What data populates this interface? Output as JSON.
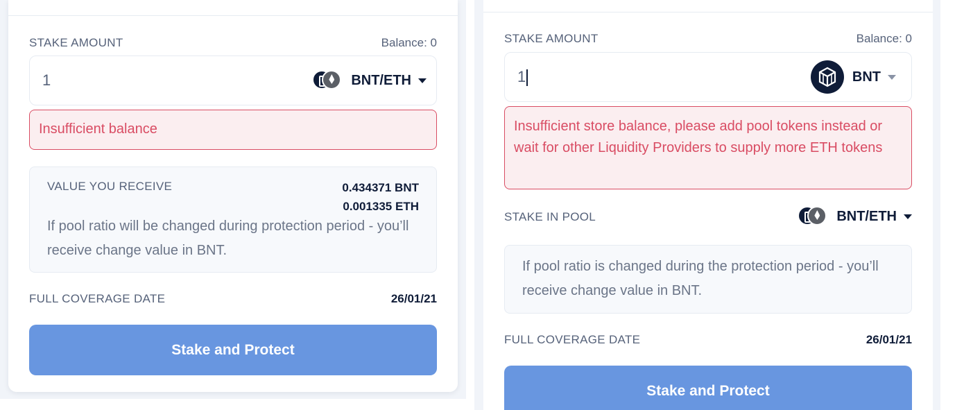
{
  "left_panel": {
    "stake_amount_label": "STAKE AMOUNT",
    "balance_text": "Balance: 0",
    "amount_value": "1",
    "token_label": "BNT/ETH",
    "token_icon": "bnt-eth-pair-icon",
    "error_message": "Insufficient balance",
    "receive_label": "VALUE YOU RECEIVE",
    "receive_bnt": "0.434371 BNT",
    "receive_eth": "0.001335 ETH",
    "note": "If pool ratio will be changed during protection period - you’ll receive change value in BNT.",
    "coverage_label": "FULL COVERAGE DATE",
    "coverage_date": "26/01/21",
    "button_label": "Stake and Protect"
  },
  "right_panel": {
    "stake_amount_label": "STAKE AMOUNT",
    "balance_text": "Balance: 0",
    "amount_value": "1",
    "token_label": "BNT",
    "token_icon": "bancor-icon",
    "error_message": "Insufficient store balance, please add pool tokens instead or wait for other Liquidity Providers to supply more ETH tokens",
    "stake_in_pool_label": "STAKE IN POOL",
    "pool_token_label": "BNT/ETH",
    "pool_token_icon": "bnt-eth-pair-icon",
    "note": "If pool ratio is changed during the protection period - you’ll receive change value in BNT.",
    "coverage_label": "FULL COVERAGE DATE",
    "coverage_date": "26/01/21",
    "button_label": "Stake and Protect"
  },
  "colors": {
    "primary_button": "#6896e0",
    "error": "#d94c63",
    "error_bg": "#fbeef0",
    "text_dark": "#0f1c38",
    "text_muted": "#56627a",
    "page_bg": "#f1f4f9"
  }
}
